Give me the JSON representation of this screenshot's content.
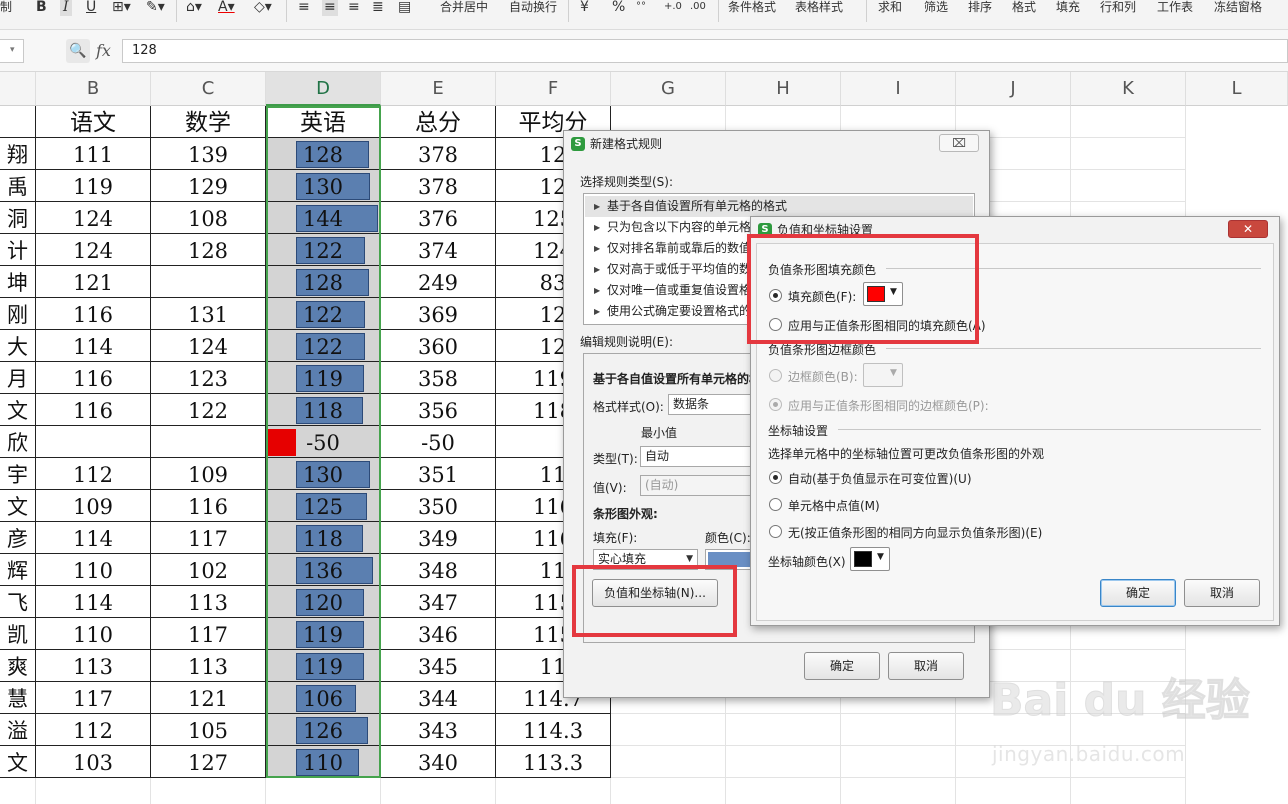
{
  "ribbon": {
    "labels": [
      "合并居中",
      "自动换行",
      "条件格式",
      "表格样式",
      "求和",
      "筛选",
      "排序",
      "格式",
      "填充",
      "行和列",
      "工作表",
      "冻结窗格"
    ],
    "glyphs": [
      "B",
      "I",
      "U",
      "¥",
      "%"
    ],
    "partial_left": "制"
  },
  "formula_bar": {
    "fx": "fx",
    "value": "128"
  },
  "columns": [
    "B",
    "C",
    "D",
    "E",
    "F",
    "G",
    "H",
    "I",
    "J",
    "K",
    "L"
  ],
  "sheet": {
    "headers": [
      "语文",
      "数学",
      "英语",
      "总分",
      "平均分"
    ],
    "rows": [
      {
        "a": "翔",
        "b": "111",
        "c": "139",
        "d": "128",
        "e": "378",
        "f": "12"
      },
      {
        "a": "禹",
        "b": "119",
        "c": "129",
        "d": "130",
        "e": "378",
        "f": "12"
      },
      {
        "a": "洞",
        "b": "124",
        "c": "108",
        "d": "144",
        "e": "376",
        "f": "125"
      },
      {
        "a": "计",
        "b": "124",
        "c": "128",
        "d": "122",
        "e": "374",
        "f": "124"
      },
      {
        "a": "坤",
        "b": "121",
        "c": "",
        "d": "128",
        "e": "249",
        "f": "83"
      },
      {
        "a": "刚",
        "b": "116",
        "c": "131",
        "d": "122",
        "e": "369",
        "f": "12"
      },
      {
        "a": "大",
        "b": "114",
        "c": "124",
        "d": "122",
        "e": "360",
        "f": "12"
      },
      {
        "a": "月",
        "b": "116",
        "c": "123",
        "d": "119",
        "e": "358",
        "f": "119"
      },
      {
        "a": "文",
        "b": "116",
        "c": "122",
        "d": "118",
        "e": "356",
        "f": "118"
      },
      {
        "a": "欣",
        "b": "",
        "c": "",
        "d": "-50",
        "e": "-50",
        "f": ""
      },
      {
        "a": "宇",
        "b": "112",
        "c": "109",
        "d": "130",
        "e": "351",
        "f": "11"
      },
      {
        "a": "文",
        "b": "109",
        "c": "116",
        "d": "125",
        "e": "350",
        "f": "116"
      },
      {
        "a": "彦",
        "b": "114",
        "c": "117",
        "d": "118",
        "e": "349",
        "f": "116"
      },
      {
        "a": "辉",
        "b": "110",
        "c": "102",
        "d": "136",
        "e": "348",
        "f": "11"
      },
      {
        "a": "飞",
        "b": "114",
        "c": "113",
        "d": "120",
        "e": "347",
        "f": "115"
      },
      {
        "a": "凯",
        "b": "110",
        "c": "117",
        "d": "119",
        "e": "346",
        "f": "115"
      },
      {
        "a": "爽",
        "b": "113",
        "c": "113",
        "d": "119",
        "e": "345",
        "f": "11"
      },
      {
        "a": "慧",
        "b": "117",
        "c": "121",
        "d": "106",
        "e": "344",
        "f": "114.7"
      },
      {
        "a": "溢",
        "b": "112",
        "c": "105",
        "d": "126",
        "e": "343",
        "f": "114.3"
      },
      {
        "a": "文",
        "b": "103",
        "c": "127",
        "d": "110",
        "e": "340",
        "f": "113.3"
      }
    ]
  },
  "databar": {
    "max_value": 144,
    "bar_color": "#5b7fb0",
    "negative_color": "#e60000",
    "axis_color": "#000000"
  },
  "rule_dialog": {
    "title": "新建格式规则",
    "close": "⌧",
    "select_type_label": "选择规则类型(S):",
    "rule_types": [
      "基于各自值设置所有单元格的格式",
      "只为包含以下内容的单元格",
      "仅对排名靠前或靠后的数值",
      "仅对高于或低于平均值的数",
      "仅对唯一值或重复值设置格",
      "使用公式确定要设置格式的"
    ],
    "edit_label": "编辑规则说明(E):",
    "edit_heading": "基于各自值设置所有单元格的格",
    "format_style_label": "格式样式(O):",
    "format_style_value": "数据条",
    "min_label": "最小值",
    "type_label": "类型(T):",
    "type_value": "自动",
    "value_label": "值(V):",
    "value_value": "(自动)",
    "appearance_label": "条形图外观:",
    "fill_label": "填充(F):",
    "color_label": "颜色(C):",
    "fill_value": "实心填充",
    "neg_axis_button": "负值和坐标轴(N)...",
    "ok": "确定",
    "cancel": "取消"
  },
  "axis_dialog": {
    "title": "负值和坐标轴设置",
    "close": "✕",
    "neg_fill_group": "负值条形图填充颜色",
    "fill_color_option": "填充颜色(F):",
    "fill_color": "#ff0000",
    "same_fill_option": "应用与正值条形图相同的填充颜色(A)",
    "neg_border_group": "负值条形图边框颜色",
    "border_color_option": "边框颜色(B):",
    "same_border_option": "应用与正值条形图相同的边框颜色(P):",
    "axis_group": "坐标轴设置",
    "axis_desc": "选择单元格中的坐标轴位置可更改负值条形图的外观",
    "axis_auto": "自动(基于负值显示在可变位置)(U)",
    "axis_mid": "单元格中点值(M)",
    "axis_none": "无(按正值条形图的相同方向显示负值条形图)(E)",
    "axis_color_label": "坐标轴颜色(X)",
    "axis_color": "#000000",
    "ok": "确定",
    "cancel": "取消"
  },
  "watermark": {
    "main": "Bai du 经验",
    "sub": "jingyan.baidu.com"
  }
}
